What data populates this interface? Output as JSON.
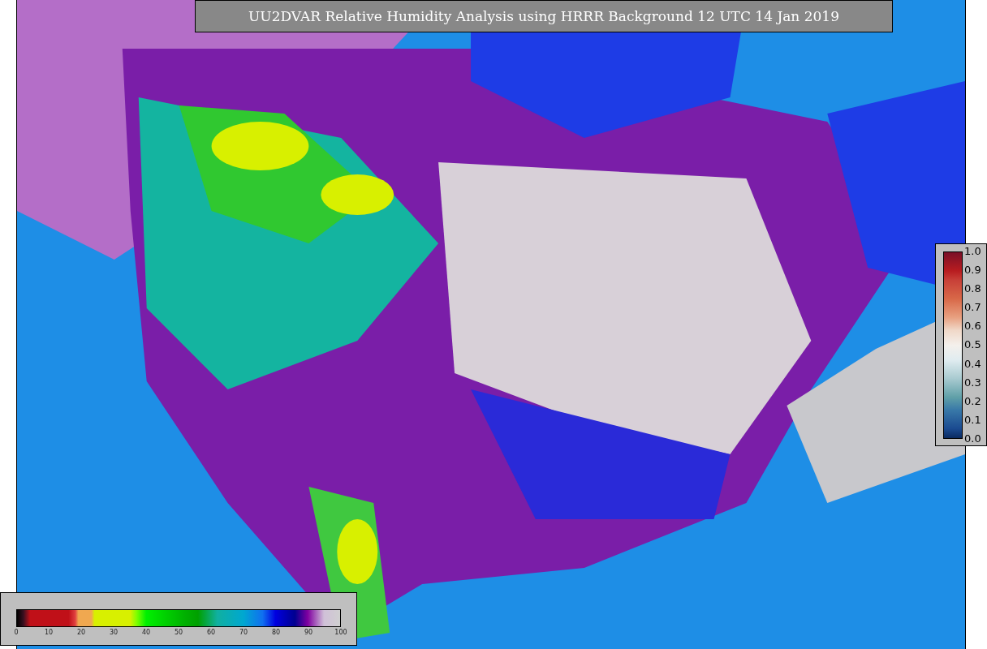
{
  "title": "UU2DVAR Relative Humidity Analysis using HRRR Background 12 UTC 14 Jan 2019",
  "humidity_colorbar": {
    "ticks": [
      "0",
      "10",
      "20",
      "30",
      "40",
      "50",
      "60",
      "70",
      "80",
      "90",
      "100"
    ]
  },
  "observation_colorbar": {
    "ticks": [
      "1.0",
      "0.9",
      "0.8",
      "0.7",
      "0.6",
      "0.5",
      "0.4",
      "0.3",
      "0.2",
      "0.1",
      "0.0"
    ]
  }
}
